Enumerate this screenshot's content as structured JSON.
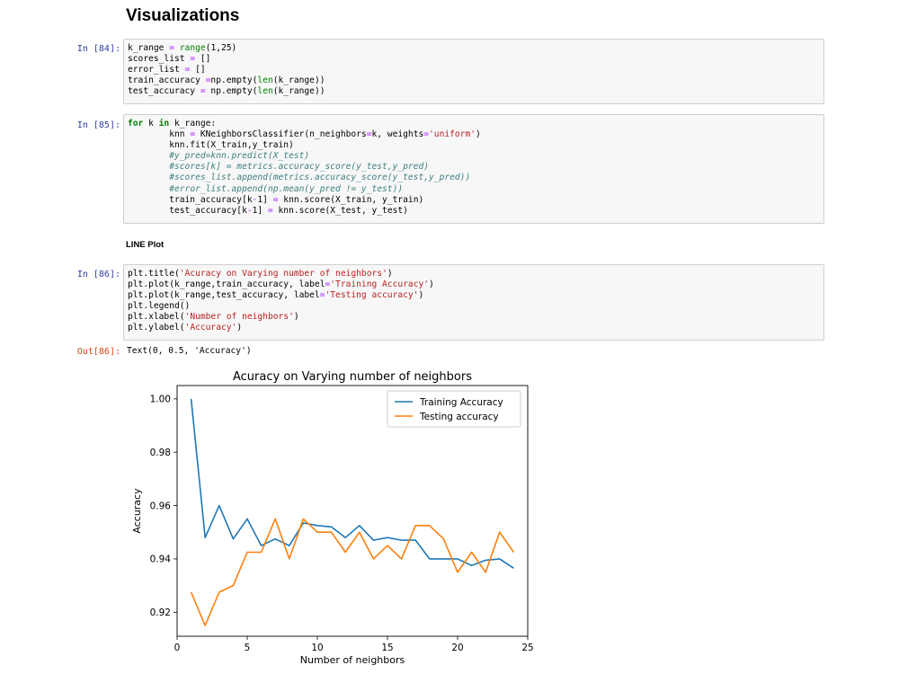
{
  "heading": "Visualizations",
  "cells": [
    {
      "prompt": "In [84]:",
      "lines": [
        [
          [
            "n",
            "k_range "
          ],
          [
            "op",
            "="
          ],
          [
            "n",
            " "
          ],
          [
            "bi",
            "range"
          ],
          [
            "n",
            "(1,25)"
          ]
        ],
        [
          [
            "n",
            "scores_list "
          ],
          [
            "op",
            "="
          ],
          [
            "n",
            " []"
          ]
        ],
        [
          [
            "n",
            "error_list "
          ],
          [
            "op",
            "="
          ],
          [
            "n",
            " []"
          ]
        ],
        [
          [
            "n",
            "train_accuracy "
          ],
          [
            "op",
            "="
          ],
          [
            "n",
            "np.empty("
          ],
          [
            "bi",
            "len"
          ],
          [
            "n",
            "(k_range))"
          ]
        ],
        [
          [
            "n",
            "test_accuracy "
          ],
          [
            "op",
            "="
          ],
          [
            "n",
            " np.empty("
          ],
          [
            "bi",
            "len"
          ],
          [
            "n",
            "(k_range))"
          ]
        ]
      ]
    },
    {
      "prompt": "In [85]:",
      "lines": [
        [
          [
            "kw",
            "for"
          ],
          [
            "n",
            " k "
          ],
          [
            "kw",
            "in"
          ],
          [
            "n",
            " k_range:"
          ]
        ],
        [
          [
            "n",
            "        knn "
          ],
          [
            "op",
            "="
          ],
          [
            "n",
            " KNeighborsClassifier(n_neighbors"
          ],
          [
            "op",
            "="
          ],
          [
            "n",
            "k, weights"
          ],
          [
            "op",
            "="
          ],
          [
            "str",
            "'uniform'"
          ],
          [
            "n",
            ")"
          ]
        ],
        [
          [
            "n",
            "        knn.fit(X_train,y_train)"
          ]
        ],
        [
          [
            "n",
            "        "
          ],
          [
            "cm",
            "#y_pred=knn.predict(X_test)"
          ]
        ],
        [
          [
            "n",
            "        "
          ],
          [
            "cm",
            "#scores[k] = metrics.accuracy_score(y_test,y_pred)"
          ]
        ],
        [
          [
            "n",
            "        "
          ],
          [
            "cm",
            "#scores_list.append(metrics.accuracy_score(y_test,y_pred))"
          ]
        ],
        [
          [
            "n",
            "        "
          ],
          [
            "cm",
            "#error_list.append(np.mean(y_pred != y_test))"
          ]
        ],
        [
          [
            "n",
            "        train_accuracy[k"
          ],
          [
            "op",
            "-"
          ],
          [
            "n",
            "1] "
          ],
          [
            "op",
            "="
          ],
          [
            "n",
            " knn.score(X_train, y_train)"
          ]
        ],
        [
          [
            "n",
            "        test_accuracy[k"
          ],
          [
            "op",
            "-"
          ],
          [
            "n",
            "1] "
          ],
          [
            "op",
            "="
          ],
          [
            "n",
            " knn.score(X_test, y_test)"
          ]
        ]
      ]
    },
    {
      "prompt": "In [86]:",
      "lines": [
        [
          [
            "n",
            "plt.title("
          ],
          [
            "str",
            "'Acuracy on Varying number of neighbors'"
          ],
          [
            "n",
            ")"
          ]
        ],
        [
          [
            "n",
            "plt.plot(k_range,train_accuracy, label"
          ],
          [
            "op",
            "="
          ],
          [
            "str",
            "'Training Accuracy'"
          ],
          [
            "n",
            ")"
          ]
        ],
        [
          [
            "n",
            "plt.plot(k_range,test_accuracy, label"
          ],
          [
            "op",
            "="
          ],
          [
            "str",
            "'Testing accuracy'"
          ],
          [
            "n",
            ")"
          ]
        ],
        [
          [
            "n",
            "plt.legend()"
          ]
        ],
        [
          [
            "n",
            "plt.xlabel("
          ],
          [
            "str",
            "'Number of neighbors'"
          ],
          [
            "n",
            ")"
          ]
        ],
        [
          [
            "n",
            "plt.ylabel("
          ],
          [
            "str",
            "'Accuracy'"
          ],
          [
            "n",
            ")"
          ]
        ]
      ]
    }
  ],
  "markdown_label": "LINE Plot",
  "output": {
    "prompt": "Out[86]:",
    "text": "Text(0, 0.5, 'Accuracy')"
  },
  "chart_data": {
    "type": "line",
    "title": "Acuracy on Varying number of neighbors",
    "xlabel": "Number of neighbors",
    "ylabel": "Accuracy",
    "xlim": [
      0,
      25
    ],
    "ylim": [
      0.911,
      1.005
    ],
    "xticks": [
      0,
      5,
      10,
      15,
      20,
      25
    ],
    "yticks": [
      0.92,
      0.94,
      0.96,
      0.98,
      1.0
    ],
    "xtick_labels": [
      "0",
      "5",
      "10",
      "15",
      "20",
      "25"
    ],
    "ytick_labels": [
      "0.92",
      "0.94",
      "0.96",
      "0.98",
      "1.00"
    ],
    "grid": false,
    "legend_position": "top-right",
    "x": [
      1,
      2,
      3,
      4,
      5,
      6,
      7,
      8,
      9,
      10,
      11,
      12,
      13,
      14,
      15,
      16,
      17,
      18,
      19,
      20,
      21,
      22,
      23,
      24
    ],
    "series": [
      {
        "name": "Training Accuracy",
        "color": "#1f77b4",
        "values": [
          1.0,
          0.948,
          0.96,
          0.9475,
          0.955,
          0.945,
          0.9475,
          0.945,
          0.9535,
          0.9525,
          0.952,
          0.948,
          0.9525,
          0.947,
          0.948,
          0.947,
          0.947,
          0.94,
          0.94,
          0.94,
          0.9375,
          0.9395,
          0.94,
          0.9365
        ]
      },
      {
        "name": "Testing accuracy",
        "color": "#ff7f0e",
        "values": [
          0.9275,
          0.915,
          0.9275,
          0.93,
          0.9425,
          0.9425,
          0.955,
          0.94,
          0.955,
          0.95,
          0.95,
          0.9425,
          0.95,
          0.94,
          0.945,
          0.94,
          0.9525,
          0.9525,
          0.9475,
          0.935,
          0.9425,
          0.935,
          0.95,
          0.9425
        ]
      }
    ]
  }
}
